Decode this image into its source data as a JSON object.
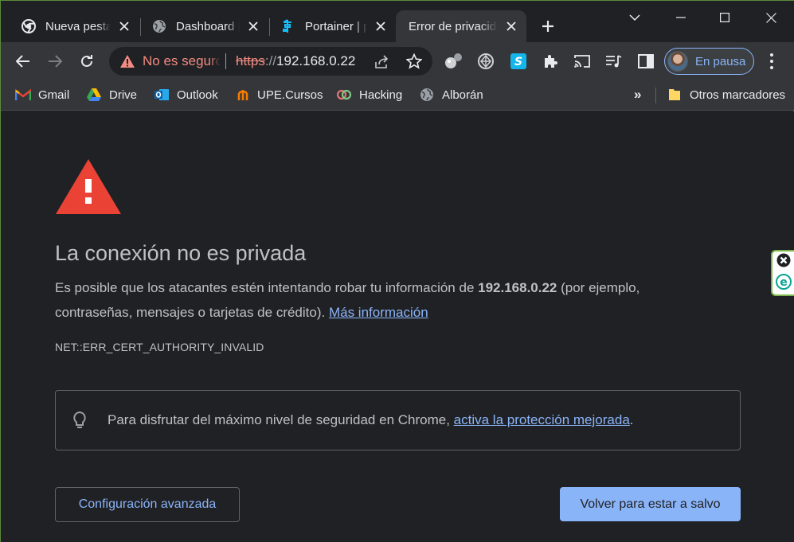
{
  "tabs": [
    {
      "title": "Nueva pestaña",
      "icon": "chrome-icon",
      "active": false
    },
    {
      "title": "Dashboard | Proxmox",
      "icon": "globe-icon",
      "active": false
    },
    {
      "title": "Portainer | portainer",
      "icon": "portainer-icon",
      "active": false
    },
    {
      "title": "Error de privacidad",
      "icon": "none",
      "active": true
    }
  ],
  "omnibox": {
    "security_label": "No es seguro",
    "scheme": "https",
    "separator": "://",
    "host": "192.168.0.22"
  },
  "profile": {
    "label": "En pausa"
  },
  "bookmarks": [
    {
      "label": "Gmail",
      "icon": "gmail-icon"
    },
    {
      "label": "Drive",
      "icon": "drive-icon"
    },
    {
      "label": "Outlook",
      "icon": "outlook-icon"
    },
    {
      "label": "UPE.Cursos",
      "icon": "upe-icon"
    },
    {
      "label": "Hacking",
      "icon": "hacking-icon"
    },
    {
      "label": "Alborán",
      "icon": "globe-icon"
    }
  ],
  "bookmarks_more": "»",
  "other_bookmarks": "Otros marcadores",
  "page": {
    "headline": "La conexión no es privada",
    "desc_pre": "Es posible que los atacantes estén intentando robar tu información de ",
    "desc_host": "192.168.0.22",
    "desc_post": " (por ejemplo, contraseñas, mensajes o tarjetas de crédito). ",
    "more_info_link": "Más información",
    "error_code": "NET::ERR_CERT_AUTHORITY_INVALID",
    "tip_pre": "Para disfrutar del máximo nivel de seguridad en Chrome, ",
    "tip_link": "activa la protección mejorada",
    "tip_post": ".",
    "advanced_button": "Configuración avanzada",
    "back_button": "Volver para estar a salvo"
  },
  "colors": {
    "background": "#202124",
    "toolbar": "#35363a",
    "warning_red": "#ea4335",
    "link_blue": "#8ab4f8",
    "insecure_red": "#f28b82"
  }
}
